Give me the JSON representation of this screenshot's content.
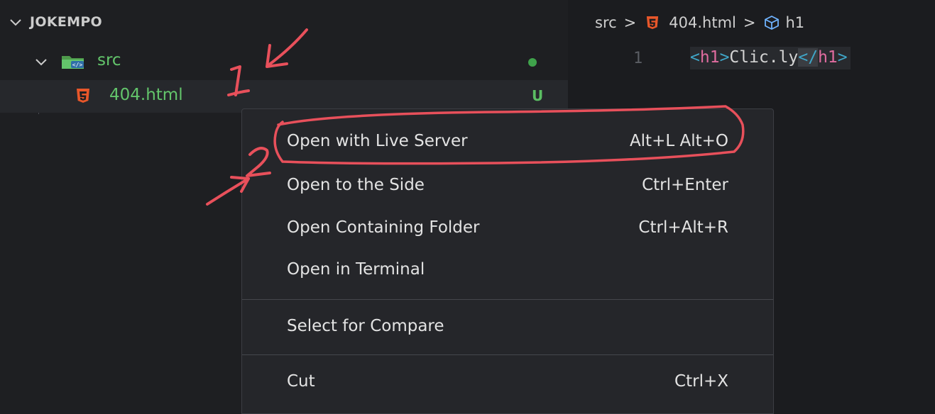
{
  "explorer": {
    "root_title": "JOKEMPO",
    "folder": {
      "label": "src",
      "status_icon": "modified-dot",
      "status_color": "#3fa24b"
    },
    "file": {
      "label": "404.html",
      "status_badge": "U",
      "icon": "html5-icon"
    }
  },
  "editor": {
    "breadcrumb": {
      "folder": "src",
      "separator": ">",
      "file": "404.html",
      "symbol": "h1"
    },
    "line_number": "1",
    "code": {
      "open_lt": "<",
      "open_name": "h1",
      "open_gt": ">",
      "text": "Clic.ly",
      "close_lt": "</",
      "close_name": "h1",
      "close_gt": ">"
    }
  },
  "context_menu": {
    "items": [
      {
        "label": "Open with Live Server",
        "shortcut": "Alt+L Alt+O"
      },
      {
        "label": "Open to the Side",
        "shortcut": "Ctrl+Enter"
      },
      {
        "label": "Open Containing Folder",
        "shortcut": "Ctrl+Alt+R"
      },
      {
        "label": "Open in Terminal",
        "shortcut": ""
      },
      {
        "label": "Select for Compare",
        "shortcut": ""
      },
      {
        "label": "Cut",
        "shortcut": "Ctrl+X"
      }
    ]
  },
  "annotations": {
    "step_one": "1",
    "step_two": "2",
    "ink_color": "#e8505b"
  },
  "colors": {
    "background": "#1e1f22",
    "menu_background": "#25262a",
    "git_untracked": "#5bbf63",
    "html_icon": "#e8572a"
  }
}
